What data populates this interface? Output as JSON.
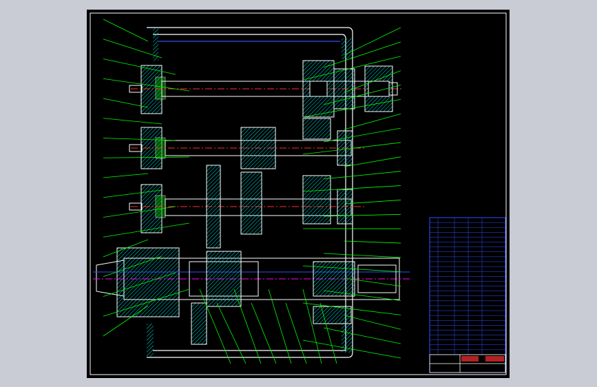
{
  "viewer": {
    "background": "#c9ccd4",
    "sheet_background": "#000000",
    "frame_color": "#ffffff"
  },
  "drawing": {
    "type": "gearbox-assembly-cad",
    "colors": {
      "outline": "#ffffff",
      "hatch": "#00e5e5",
      "leader": "#00ff00",
      "centerline": "#ff3030",
      "spindle_centerline": "#ff00ff",
      "blue": "#3050ff",
      "yellow": "#ffff00",
      "title_block": "#3050ff"
    },
    "balloons_left_count": 17,
    "balloons_right_count": 24,
    "balloons_bottom_count": 8
  },
  "title_block": {
    "rows": 28,
    "color_hex": "#3050ff"
  }
}
